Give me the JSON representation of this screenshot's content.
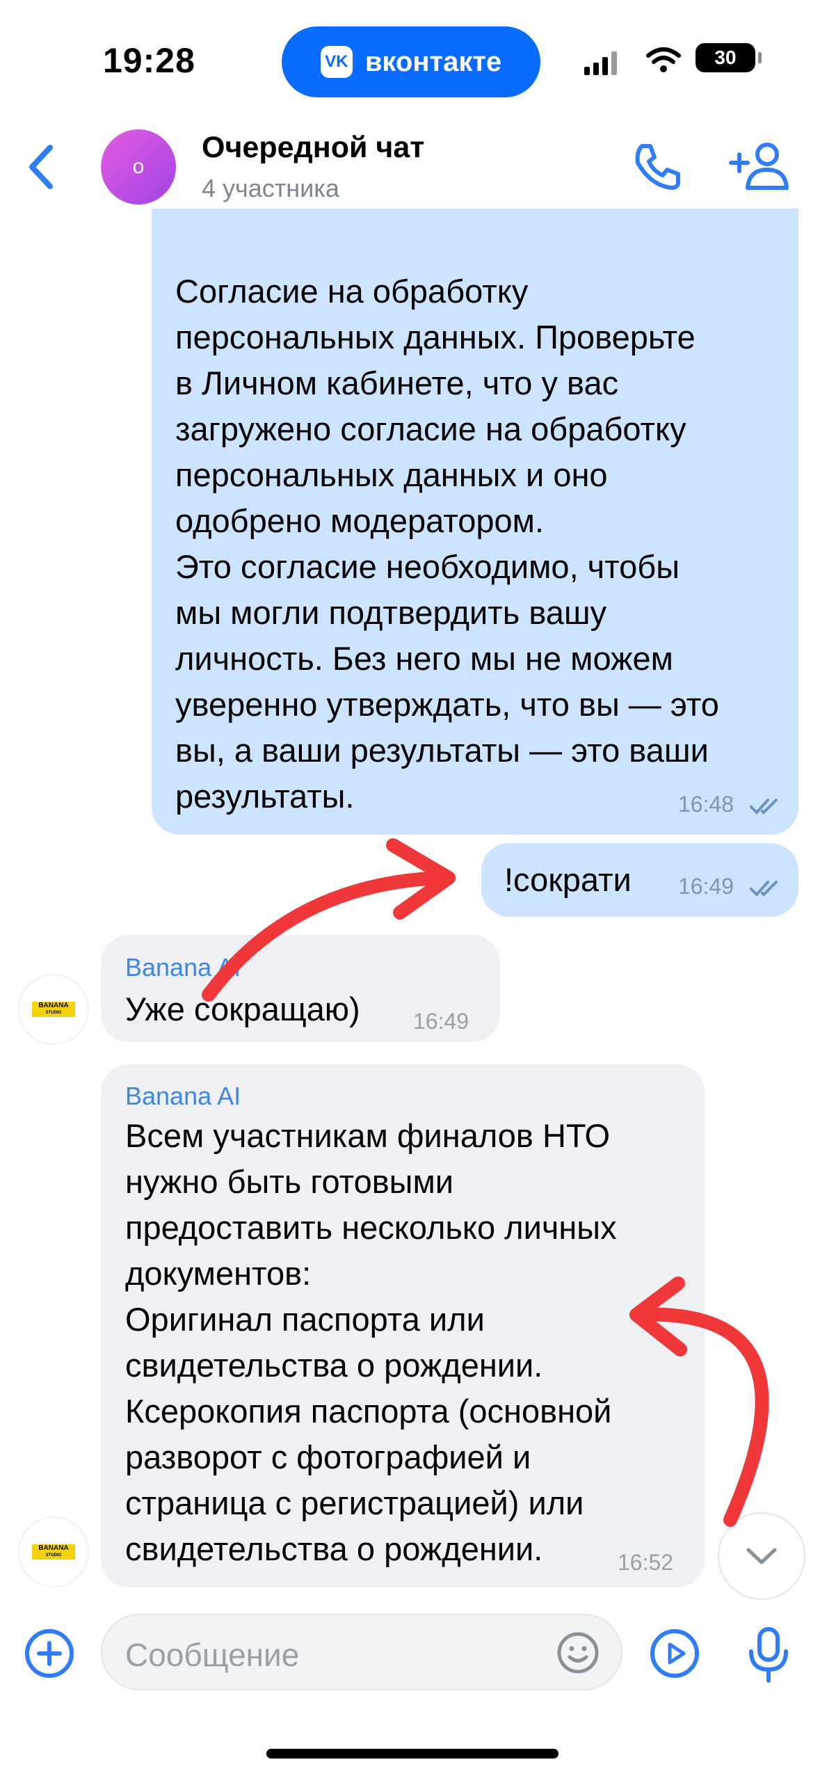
{
  "status_bar": {
    "time": "19:28",
    "app_pill_label": "вконтакте",
    "app_pill_logo": "VK",
    "battery": "30"
  },
  "header": {
    "avatar_letter": "о",
    "title": "Очередной чат",
    "subtitle": "4 участника"
  },
  "messages": [
    {
      "direction": "outgoing",
      "text": "Согласие на обработку\nперсональных данных. Проверьте\nв Личном кабинете, что у вас\nзагружено согласие на обработку\nперсональных данных и оно\nодобрено модератором.\nЭто согласие необходимо, чтобы\nмы могли подтвердить вашу\nличность. Без него мы не можем\nуверенно утверждать, что вы — это\nвы, а ваши результаты — это ваши\nрезультаты.",
      "time": "16:48",
      "read": true
    },
    {
      "direction": "outgoing",
      "text": "!сократи",
      "time": "16:49",
      "read": true
    },
    {
      "direction": "incoming",
      "sender": "Banana AI",
      "text": "Уже сокращаю)",
      "time": "16:49"
    },
    {
      "direction": "incoming",
      "sender": "Banana AI",
      "text": "Всем участникам финалов НТО\nнужно быть готовыми\nпредоставить несколько личных\nдокументов:\nОригинал паспорта или\nсвидетельства о рождении.\nКсерокопия паспорта (основной\nразворот с фотографией и\nстраница с регистрацией) или\nсвидетельства о рождении.",
      "time": "16:52"
    }
  ],
  "sender_avatar": {
    "line1": "BANANA",
    "line2": "STUDIO"
  },
  "composer": {
    "placeholder": "Сообщение"
  },
  "colors": {
    "accent": "#0a6cff",
    "outgoing_bubble": "#cce4ff",
    "incoming_bubble": "#eef0f3",
    "annotation_arrow": "#f0383b"
  },
  "icons": [
    "back-icon",
    "phone-icon",
    "add-user-icon",
    "plus-icon",
    "emoji-icon",
    "play-icon",
    "microphone-icon",
    "chevron-down-icon",
    "double-check-icon",
    "wifi-icon",
    "signal-icon",
    "battery-icon"
  ]
}
